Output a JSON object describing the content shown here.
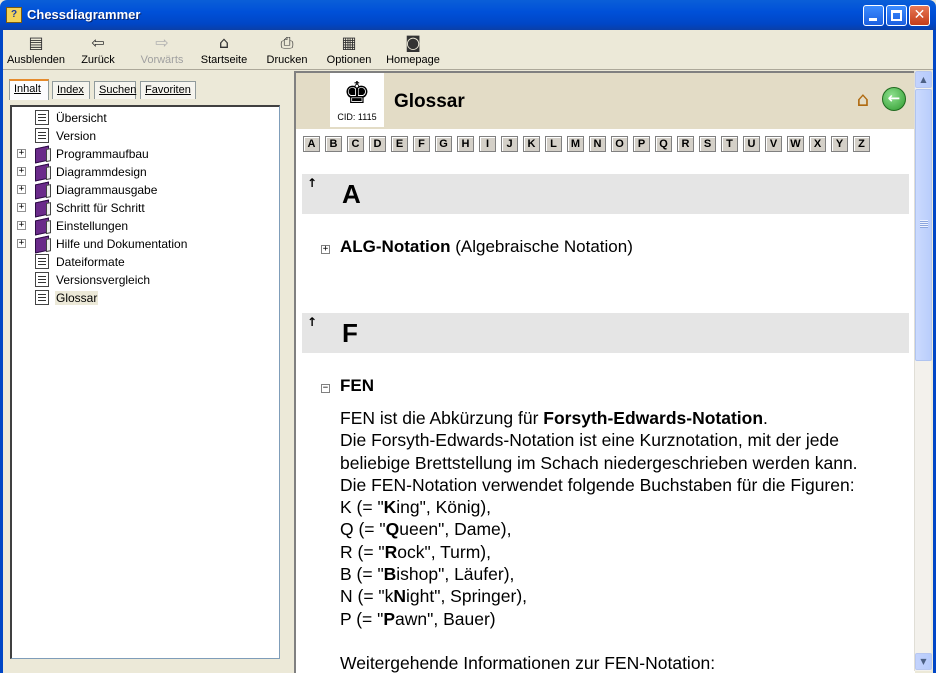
{
  "window": {
    "title": "Chessdiagrammer",
    "app_icon_glyph": "?"
  },
  "toolbar": {
    "hide": "Ausblenden",
    "back": "Zurück",
    "forward": "Vorwärts",
    "home": "Startseite",
    "print": "Drucken",
    "options": "Optionen",
    "homepage": "Homepage"
  },
  "tabs": {
    "content": "Inhalt",
    "index": "Index",
    "search": "Suchen",
    "favorites": "Favoriten"
  },
  "tree": {
    "items": [
      {
        "label": "Übersicht",
        "type": "page",
        "expandable": false
      },
      {
        "label": "Version",
        "type": "page",
        "expandable": false
      },
      {
        "label": "Programmaufbau",
        "type": "book",
        "expandable": true
      },
      {
        "label": "Diagrammdesign",
        "type": "book",
        "expandable": true
      },
      {
        "label": "Diagrammausgabe",
        "type": "book",
        "expandable": true
      },
      {
        "label": "Schritt für Schritt",
        "type": "book",
        "expandable": true
      },
      {
        "label": "Einstellungen",
        "type": "book",
        "expandable": true
      },
      {
        "label": "Hilfe und Dokumentation",
        "type": "book",
        "expandable": true
      },
      {
        "label": "Dateiformate",
        "type": "page",
        "expandable": false
      },
      {
        "label": "Versionsvergleich",
        "type": "page",
        "expandable": false
      },
      {
        "label": "Glossar",
        "type": "page",
        "expandable": false,
        "selected": true
      }
    ]
  },
  "header": {
    "cid": "CID: 1115",
    "title": "Glossar",
    "icons": [
      "king-icon",
      "home-icon",
      "back-icon"
    ]
  },
  "alphabet": [
    "A",
    "B",
    "C",
    "D",
    "E",
    "F",
    "G",
    "H",
    "I",
    "J",
    "K",
    "L",
    "M",
    "N",
    "O",
    "P",
    "Q",
    "R",
    "S",
    "T",
    "U",
    "V",
    "W",
    "X",
    "Y",
    "Z"
  ],
  "sections": [
    {
      "letter": "A",
      "entries": [
        {
          "term": "ALG-Notation",
          "extra": "(Algebraische Notation)",
          "expanded": false
        }
      ]
    },
    {
      "letter": "F",
      "entries": [
        {
          "term": "FEN",
          "expanded": true
        }
      ]
    }
  ],
  "fen_text": {
    "l1_a": "FEN ist die Abkürzung für ",
    "l1_b": "Forsyth-Edwards-Notation",
    "l1_c": ".",
    "l2": "Die Forsyth-Edwards-Notation ist eine Kurznotation, mit der jede",
    "l3": "beliebige Brettstellung im Schach niedergeschrieben werden kann.",
    "l4": "Die FEN-Notation verwendet folgende Buchstaben für die Figuren:",
    "pieces": [
      {
        "pre": "K (= \"",
        "bold": "K",
        "rest": "ing\", König),"
      },
      {
        "pre": "Q (= \"",
        "bold": "Q",
        "rest": "ueen\", Dame),"
      },
      {
        "pre": "R (= \"",
        "bold": "R",
        "rest": "ock\", Turm),"
      },
      {
        "pre": "B (= \"",
        "bold": "B",
        "rest": "ishop\", Läufer),"
      },
      {
        "pre": "N (= \"k",
        "bold": "N",
        "rest": "ight\", Springer),"
      },
      {
        "pre": "P (= \"",
        "bold": "P",
        "rest": "awn\", Bauer)"
      }
    ],
    "more": "Weitergehende Informationen zur FEN-Notation:"
  },
  "colors": {
    "titlebar": "#0050d8",
    "header_band": "#e3dcc6",
    "section_band": "#e5e5e5",
    "book": "#6a2a8a"
  }
}
